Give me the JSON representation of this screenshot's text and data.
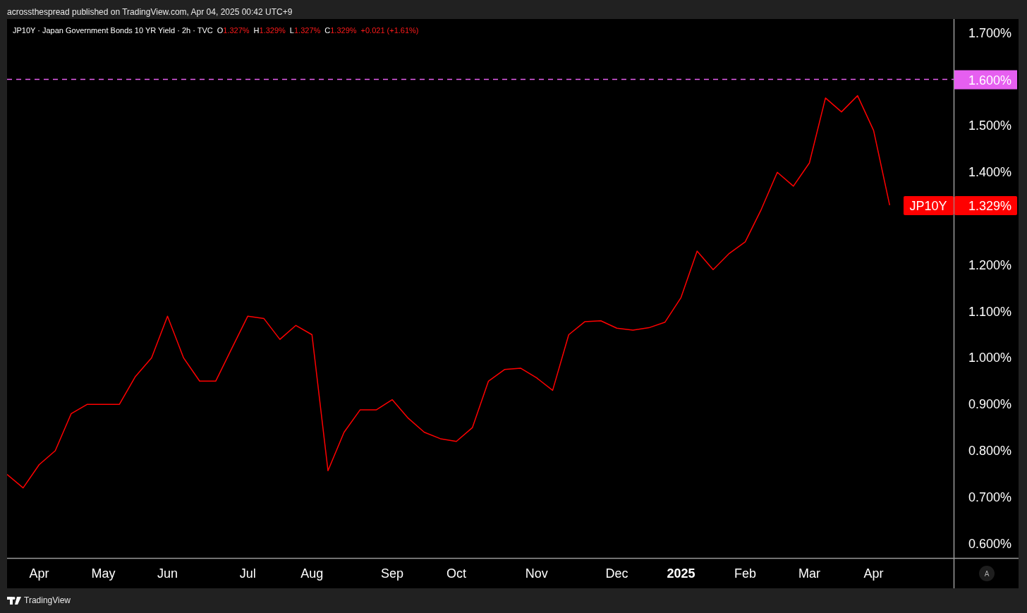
{
  "attribution": "acrossthespread published on TradingView.com, Apr 04, 2025 00:42 UTC+9",
  "legend": {
    "symbol": "JP10Y · Japan Government Bonds 10 YR Yield · 2h · TVC",
    "ohlc": [
      {
        "key": "O",
        "value": "1.327%"
      },
      {
        "key": "H",
        "value": "1.329%"
      },
      {
        "key": "L",
        "value": "1.327%"
      },
      {
        "key": "C",
        "value": "1.329%"
      }
    ],
    "change": "+0.021 (+1.61%)"
  },
  "chart_data": {
    "type": "line",
    "ylim": [
      0.569,
      1.73
    ],
    "categories": [
      null,
      null,
      "Apr",
      null,
      null,
      null,
      "May",
      null,
      null,
      null,
      "Jun",
      null,
      null,
      null,
      null,
      "Jul",
      null,
      null,
      null,
      "Aug",
      null,
      null,
      null,
      null,
      "Sep",
      null,
      null,
      null,
      "Oct",
      null,
      null,
      null,
      null,
      "Nov",
      null,
      null,
      null,
      null,
      "Dec",
      null,
      null,
      null,
      "2025",
      null,
      null,
      null,
      "Feb",
      null,
      null,
      null,
      "Mar",
      null,
      null,
      null,
      "Apr",
      null
    ],
    "series": [
      {
        "name": "JP10Y",
        "color": "#ff0000",
        "values": [
          0.749,
          0.72,
          0.77,
          0.8,
          0.88,
          0.9,
          0.9,
          0.9,
          0.96,
          1.0,
          1.09,
          1.0,
          0.95,
          0.95,
          1.02,
          1.09,
          1.085,
          1.04,
          1.07,
          1.05,
          0.757,
          0.84,
          0.888,
          0.888,
          0.91,
          0.87,
          0.84,
          0.826,
          0.82,
          0.85,
          0.95,
          0.975,
          0.978,
          0.957,
          0.93,
          1.05,
          1.078,
          1.08,
          1.064,
          1.06,
          1.065,
          1.077,
          1.13,
          1.23,
          1.19,
          1.225,
          1.25,
          1.32,
          1.4,
          1.37,
          1.42,
          1.56,
          1.53,
          1.565,
          1.49,
          1.329
        ]
      }
    ],
    "yticks": [
      {
        "value": 1.7,
        "label": "1.700%"
      },
      {
        "value": 1.6,
        "label": "1.600%"
      },
      {
        "value": 1.5,
        "label": "1.500%"
      },
      {
        "value": 1.4,
        "label": "1.400%"
      },
      {
        "value": 1.2,
        "label": "1.200%"
      },
      {
        "value": 1.1,
        "label": "1.100%"
      },
      {
        "value": 1.0,
        "label": "1.000%"
      },
      {
        "value": 0.9,
        "label": "0.900%"
      },
      {
        "value": 0.8,
        "label": "0.800%"
      },
      {
        "value": 0.7,
        "label": "0.700%"
      },
      {
        "value": 0.6,
        "label": "0.600%"
      }
    ],
    "ref_lines": [
      {
        "axis": "y",
        "value": 1.6,
        "color": "#e65ff0"
      }
    ],
    "annotations": [
      {
        "text": "1.329%"
      }
    ]
  },
  "scale_button": "A",
  "footer": "TradingView"
}
